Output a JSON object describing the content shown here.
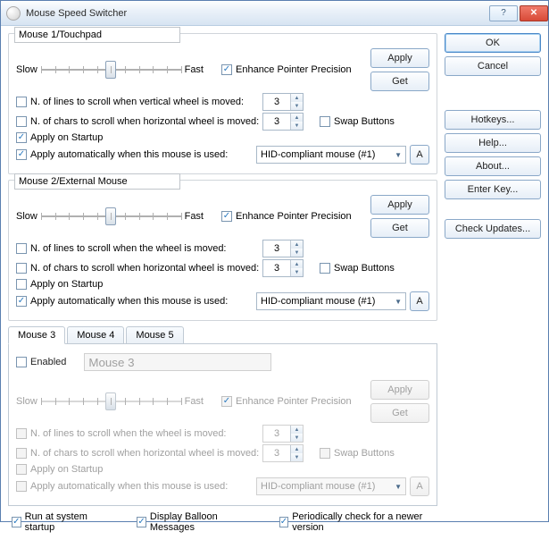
{
  "window": {
    "title": "Mouse Speed Switcher"
  },
  "side": {
    "ok": "OK",
    "cancel": "Cancel",
    "hotkeys": "Hotkeys...",
    "help": "Help...",
    "about": "About...",
    "enterkey": "Enter Key...",
    "check": "Check Updates..."
  },
  "common": {
    "slow": "Slow",
    "fast": "Fast",
    "enhance": "Enhance Pointer Precision",
    "apply": "Apply",
    "get": "Get",
    "swap": "Swap Buttons",
    "apply_startup": "Apply on Startup",
    "apply_auto": "Apply automatically when this mouse is used:",
    "device": "HID-compliant mouse (#1)",
    "a_btn": "A",
    "lines_v": "N. of lines to scroll when vertical wheel is moved:",
    "lines_w": "N. of lines to scroll when the wheel is moved:",
    "chars_h": "N. of chars to scroll when  horizontal wheel is moved:",
    "val3": "3"
  },
  "m1": {
    "name": "Mouse 1/Touchpad",
    "enhance_checked": true,
    "startup_checked": true,
    "auto_checked": true
  },
  "m2": {
    "name": "Mouse 2/External Mouse",
    "enhance_checked": true,
    "startup_checked": false,
    "auto_checked": true
  },
  "tabs": {
    "t3": "Mouse 3",
    "t4": "Mouse 4",
    "t5": "Mouse 5"
  },
  "m3": {
    "enabled_label": "Enabled",
    "name": "Mouse 3",
    "enhance_checked": true
  },
  "bottom": {
    "run": "Run at system startup",
    "balloon": "Display Balloon Messages",
    "check": "Periodically check for a newer version"
  }
}
